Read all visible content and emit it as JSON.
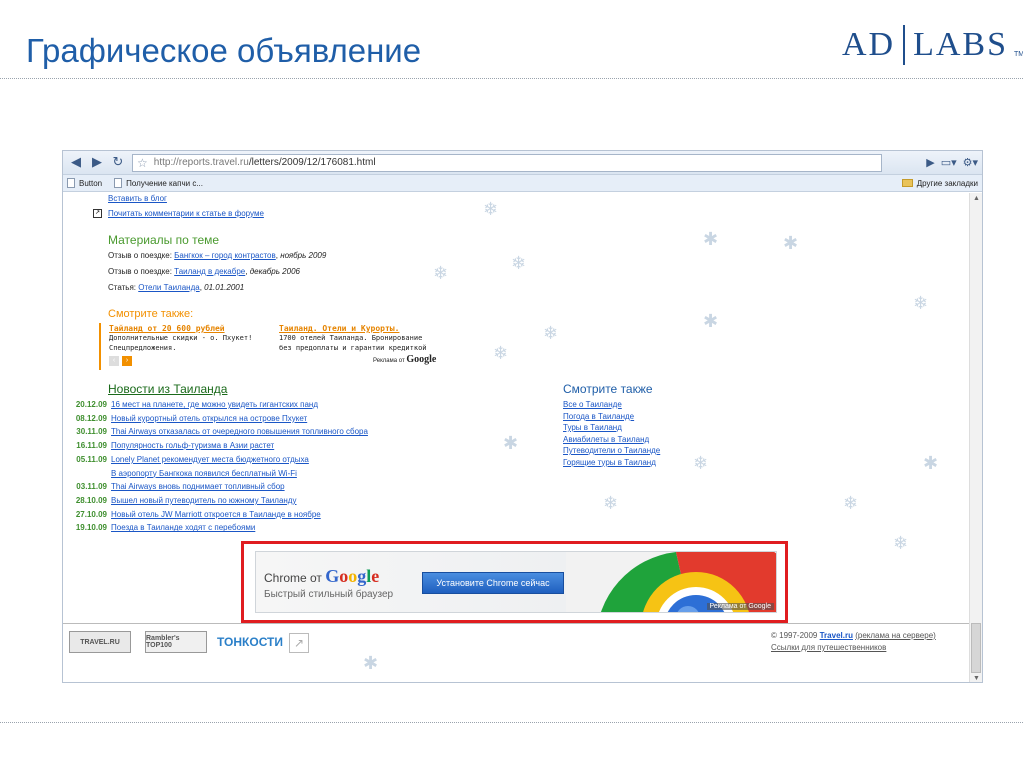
{
  "slide": {
    "title": "Графическое объявление",
    "logo_left": "AD",
    "logo_right": "LABS",
    "logo_tm": "TM"
  },
  "browser": {
    "url_host": "http://reports.travel.ru",
    "url_path": "/letters/2009/12/176081.html",
    "bookmarks": [
      "Button",
      "Получение капчи с..."
    ],
    "other_bookmarks": "Другие закладки"
  },
  "page": {
    "top_links": [
      "Вставить в блог",
      "Почитать комментарии к статье в форуме"
    ],
    "materials": {
      "title": "Материалы по теме",
      "rows": [
        {
          "prefix": "Отзыв о поездке:",
          "link": "Бангкок – город контрастов",
          "suffix": "ноябрь 2009"
        },
        {
          "prefix": "Отзыв о поездке:",
          "link": "Таиланд в декабре",
          "suffix": "декабрь 2006"
        },
        {
          "prefix": "Статья:",
          "link": "Отели Таиланда",
          "suffix": "01.01.2001"
        }
      ]
    },
    "see_also_ads": {
      "title": "Смотрите также:",
      "ads": [
        {
          "title": "Тайланд от 20 600 рублей",
          "lines": [
            "Дополнительные скидки - о. Пхукет!",
            "Спецпредложения."
          ]
        },
        {
          "title": "Таиланд. Отели и Курорты.",
          "lines": [
            "1700 отелей Таиланда. Бронирование",
            "без предоплаты и гарантии кредиткой"
          ]
        }
      ],
      "ads_by": "Реклама от",
      "google": "Google"
    },
    "news": {
      "title": "Новости из Таиланда",
      "items": [
        {
          "date": "20.12.09",
          "text": "16 мест на планете, где можно увидеть гигантских панд"
        },
        {
          "date": "08.12.09",
          "text": "Новый курортный отель открылся на острове Пхукет"
        },
        {
          "date": "30.11.09",
          "text": "Thai Airways отказалась от очередного повышения топливного сбора"
        },
        {
          "date": "16.11.09",
          "text": "Популярность гольф-туризма в Азии растет"
        },
        {
          "date": "05.11.09",
          "text": "Lonely Planet рекомендует места бюджетного отдыха"
        },
        {
          "date": "",
          "text": "В аэропорту Бангкока появился бесплатный Wi-Fi"
        },
        {
          "date": "03.11.09",
          "text": "Thai Airways вновь поднимает топливный сбор"
        },
        {
          "date": "28.10.09",
          "text": "Вышел новый путеводитель по южному Таиланду"
        },
        {
          "date": "27.10.09",
          "text": "Новый отель JW Marriott откроется в Таиланде в ноябре"
        },
        {
          "date": "19.10.09",
          "text": "Поезда в Таиланде ходят с перебоями"
        }
      ]
    },
    "see_also": {
      "title": "Смотрите также",
      "links": [
        "Все о Таиланде",
        "Погода в Таиланде",
        "Туры в Таиланд",
        "Авиабилеты в Таиланд",
        "Путеводители о Таиланде",
        "Горящие туры в Таиланд"
      ]
    },
    "banner": {
      "title_prefix": "Chrome от",
      "google": "Google",
      "subtitle": "Быстрый стильный браузер",
      "button": "Установите Chrome сейчас",
      "ads_by": "Реклама от Google"
    },
    "footer": {
      "badges": [
        "TRAVEL.RU",
        "Rambler's TOP100",
        "ТОНКОСТИ"
      ],
      "copyright": "© 1997-2009",
      "site": "Travel.ru",
      "ad_link": "(реклама на сервере)",
      "links_text": "Ссылки для путешественников"
    }
  },
  "colors": {
    "accent": "#1f5ea8",
    "frame_red": "#e01d20",
    "news_green": "#3f8f2f"
  }
}
